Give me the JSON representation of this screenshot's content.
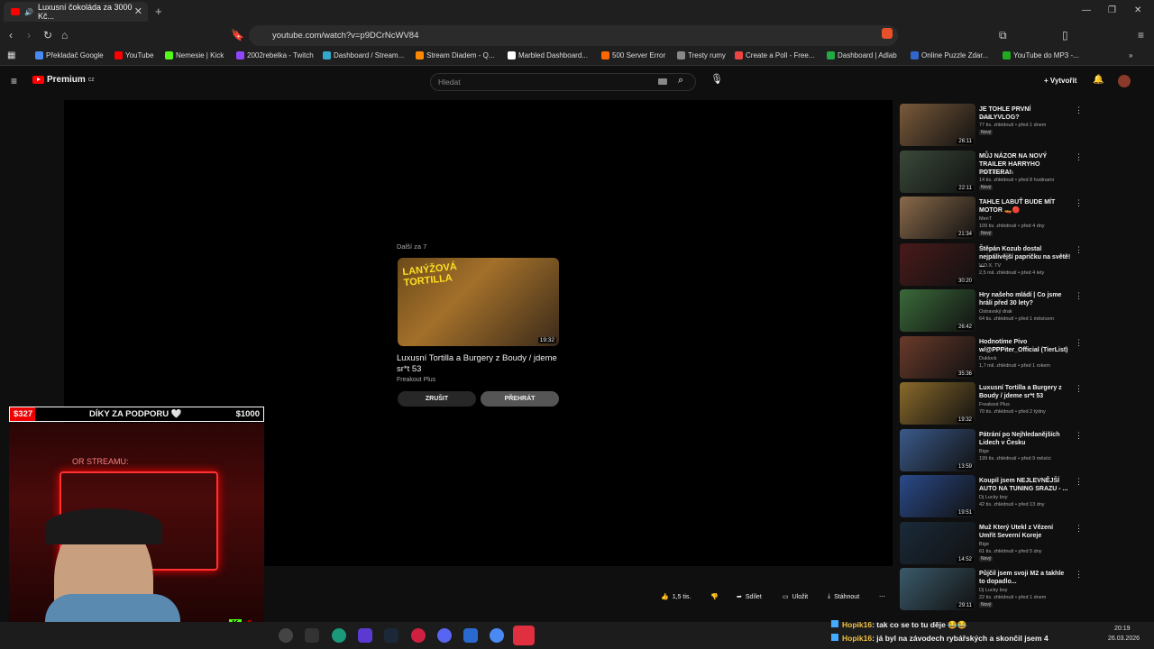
{
  "browser": {
    "tab_title": "Luxusní čokoláda za 3000 Kč...",
    "url": "youtube.com/watch?v=p9DCrNcWV84",
    "bookmarks": [
      "Překladač Google",
      "YouTube",
      "Nemesie | Kick",
      "2002rebelka - Twitch",
      "Dashboard / Stream...",
      "Stream Diadem - Q...",
      "Marbled Dashboard...",
      "500 Server Error",
      "Tresty rumy",
      "Create a Poll - Free...",
      "Dashboard | Adlab",
      "Online Puzzle Zdar...",
      "YouTube do MP3 -..."
    ]
  },
  "yt": {
    "logo_text": "Premium",
    "logo_sup": "CZ",
    "search_placeholder": "Hledat",
    "create_label": "Vytvořit"
  },
  "upnext": {
    "label": "Další za 7",
    "title": "Luxusní Tortilla a Burgery z Boudy / jdeme sr*t 53",
    "channel": "Freakout Plus",
    "duration": "19:32",
    "thumb_text": "LANÝŽOVÁ TORTILLA",
    "cancel_label": "ZRUŠIT",
    "play_label": "PŘEHRÁT"
  },
  "actions": {
    "likes": "1,5 tis.",
    "share": "Sdílet",
    "save": "Uložit",
    "download": "Stáhnout"
  },
  "sidebar": [
    {
      "title": "JE TOHLE PRVNÍ DAILYVLOG?",
      "channel": "MenT",
      "meta": "77 tis. zhlédnutí • před 1 dnem",
      "new": "Nový",
      "duration": "26:11",
      "color": "#7a5a3a"
    },
    {
      "title": "MŮJ NÁZOR NA NOVÝ TRAILER HARRYHO POTTERA!",
      "channel": "Lůk Extra a Lůk",
      "meta": "14 tis. zhlédnutí • před 8 hodinami",
      "new": "Nový",
      "duration": "22:11",
      "color": "#3a4a3a"
    },
    {
      "title": "TAHLE LABUŤ BUDE MÍT MOTOR 🚤🔴",
      "channel": "MenT",
      "meta": "109 tis. zhlédnutí • před 4 dny",
      "new": "Nový",
      "duration": "21:34",
      "color": "#8a6a4a"
    },
    {
      "title": "Štěpán Kozub dostal nejpálivější papričku na světě! ...",
      "channel": "V.O.X. TV",
      "meta": "2,5 mil. zhlédnutí • před 4 lety",
      "new": "",
      "duration": "30:20",
      "color": "#4a1a1a"
    },
    {
      "title": "Hry našeho mládí | Co jsme hráli před 30 lety?",
      "channel": "Ostravský drak",
      "meta": "64 tis. zhlédnutí • před 1 měsícem",
      "new": "",
      "duration": "26:42",
      "color": "#3a6a3a"
    },
    {
      "title": "Hodnotíme Pivo w/@PPPiter_Official (TierList)",
      "channel": "Duklock",
      "meta": "1,7 mil. zhlédnutí • před 1 rokem",
      "new": "",
      "duration": "35:36",
      "color": "#6a3a2a"
    },
    {
      "title": "Luxusní Tortilla a Burgery z Boudy / jdeme sr*t 53",
      "channel": "Freakout Plus",
      "meta": "70 tis. zhlédnutí • před 2 týdny",
      "new": "",
      "duration": "19:32",
      "color": "#8a6a2a"
    },
    {
      "title": "Pátrání po Nejhledanějších Lidech v Česku",
      "channel": "Bige",
      "meta": "199 tis. zhlédnutí • před 9 měsíci",
      "new": "",
      "duration": "13:59",
      "color": "#3a5a8a"
    },
    {
      "title": "Koupil jsem NEJLEVNĚJŠÍ AUTO NA TUNING SRAZU - ...",
      "channel": "Dj Lucky boy",
      "meta": "42 tis. zhlédnutí • před 13 dny",
      "new": "",
      "duration": "19:51",
      "color": "#2a4a8a"
    },
    {
      "title": "Muž Který Utekl z Vězení Umřít Severní Koreje",
      "channel": "Bige",
      "meta": "61 tis. zhlédnutí • před 5 dny",
      "new": "Nový",
      "duration": "14:52",
      "color": "#1a2a3a"
    },
    {
      "title": "Půjčil jsem svoji M2 a takhle to dopadlo...",
      "channel": "Dj Lucky boy",
      "meta": "22 tis. zhlédnutí • před 1 dnem",
      "new": "Nový",
      "duration": "29:11",
      "color": "#3a5a6a"
    }
  ],
  "stream": {
    "donation_current": "$327",
    "donation_text": "DÍKY ZA PODPORU 🤍",
    "donation_goal": "$1000",
    "donation_progress": 0.327,
    "cam_text": "OR STREAMU:",
    "kick_count": "6"
  },
  "chat": [
    {
      "user": "Hopik16",
      "msg": ": tak co se to tu děje 😂😂"
    },
    {
      "user": "Hopik16",
      "msg": ": já byl na závodech rybářských a skončil jsem 4"
    }
  ],
  "clock": {
    "time": "20:19",
    "date": "26.03.2026"
  }
}
